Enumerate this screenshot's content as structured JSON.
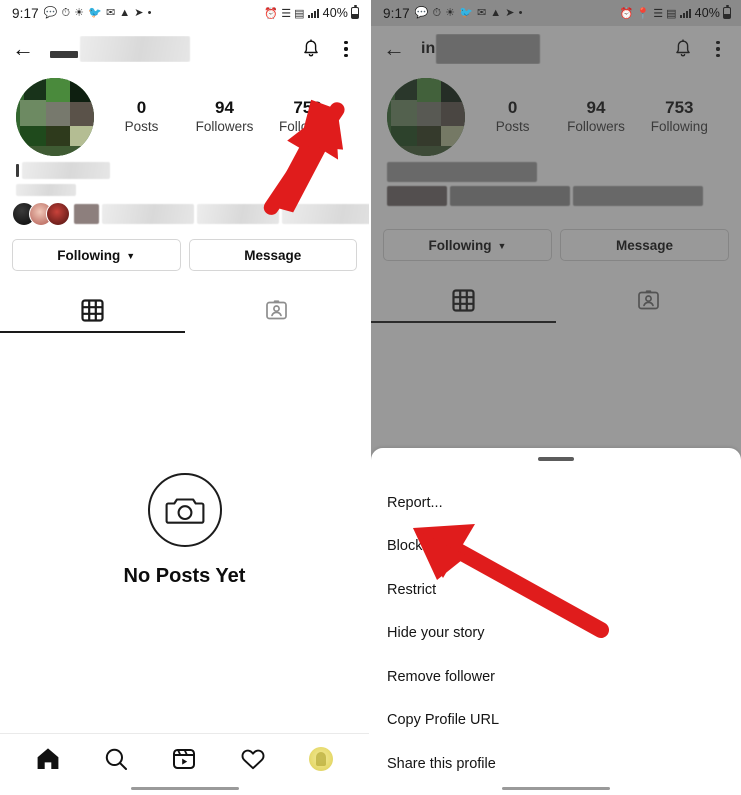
{
  "screens": [
    {
      "id": "profile",
      "status_bar": {
        "time": "9:17",
        "left_icons": [
          "whatsapp-icon",
          "clock-icon",
          "app-icon",
          "twitter-icon",
          "gmail-icon",
          "upload-icon",
          "telegram-icon",
          "dot-icon"
        ],
        "right_icons": [
          "alarm-icon",
          "wifi-icon",
          "data-icon",
          "signal-icon"
        ],
        "battery": "40%"
      },
      "header": {
        "back": "back-arrow",
        "username": "",
        "username_redacted": true,
        "notification": "bell-icon",
        "overflow": "kebab-menu"
      },
      "stats": [
        {
          "value": "0",
          "label": "Posts"
        },
        {
          "value": "94",
          "label": "Followers"
        },
        {
          "value": "753",
          "label": "Following"
        }
      ],
      "bio_redacted": true,
      "mutual_followers_redacted": true,
      "buttons": {
        "follow": "Following",
        "follow_caret": "⌄",
        "message": "Message"
      },
      "tabs": [
        {
          "name": "grid-tab",
          "icon": "grid-icon",
          "active": true
        },
        {
          "name": "tagged-tab",
          "icon": "tagged-icon",
          "active": false
        }
      ],
      "empty_state": {
        "icon": "camera-icon",
        "text": "No Posts Yet"
      },
      "bottom_nav": [
        {
          "name": "home",
          "icon": "home-icon",
          "active": true
        },
        {
          "name": "search",
          "icon": "search-icon",
          "active": false
        },
        {
          "name": "reels",
          "icon": "reels-icon",
          "active": false
        },
        {
          "name": "activity",
          "icon": "heart-icon",
          "active": false
        },
        {
          "name": "profile",
          "icon": "profile-avatar",
          "active": false
        }
      ],
      "annotation": {
        "arrow": "red-arrow-to-kebab-menu",
        "color": "#e01c1c"
      }
    },
    {
      "id": "profile-options-sheet",
      "status_bar": {
        "time": "9:17",
        "left_icons": [
          "whatsapp-icon",
          "clock-icon",
          "app-icon",
          "twitter-icon",
          "gmail-icon",
          "upload-icon",
          "telegram-icon",
          "dot-icon"
        ],
        "right_icons": [
          "alarm-icon",
          "location-icon",
          "wifi-icon",
          "data-icon",
          "signal-icon"
        ],
        "battery": "40%"
      },
      "header": {
        "back": "back-arrow",
        "username": "in",
        "username_redacted": true,
        "notification": "bell-icon",
        "overflow": "kebab-menu"
      },
      "stats": [
        {
          "value": "0",
          "label": "Posts"
        },
        {
          "value": "94",
          "label": "Followers"
        },
        {
          "value": "753",
          "label": "Following"
        }
      ],
      "bio_redacted": true,
      "buttons": {
        "follow": "Following",
        "follow_caret": "⌄",
        "message": "Message"
      },
      "tabs": [
        {
          "name": "grid-tab",
          "icon": "grid-icon",
          "active": true
        },
        {
          "name": "tagged-tab",
          "icon": "tagged-icon",
          "active": false
        }
      ],
      "sheet": {
        "handle": "drag-handle",
        "items": [
          "Report...",
          "Block",
          "Restrict",
          "Hide your story",
          "Remove follower",
          "Copy Profile URL",
          "Share this profile"
        ]
      },
      "annotation": {
        "arrow": "red-arrow-to-block-item",
        "color": "#e01c1c"
      }
    }
  ],
  "colors": {
    "accent_red": "#e01c1c",
    "text_primary": "#111111",
    "text_secondary": "#3a3a3a",
    "border": "#d6d6d6",
    "overlay": "#7f7f7f"
  }
}
